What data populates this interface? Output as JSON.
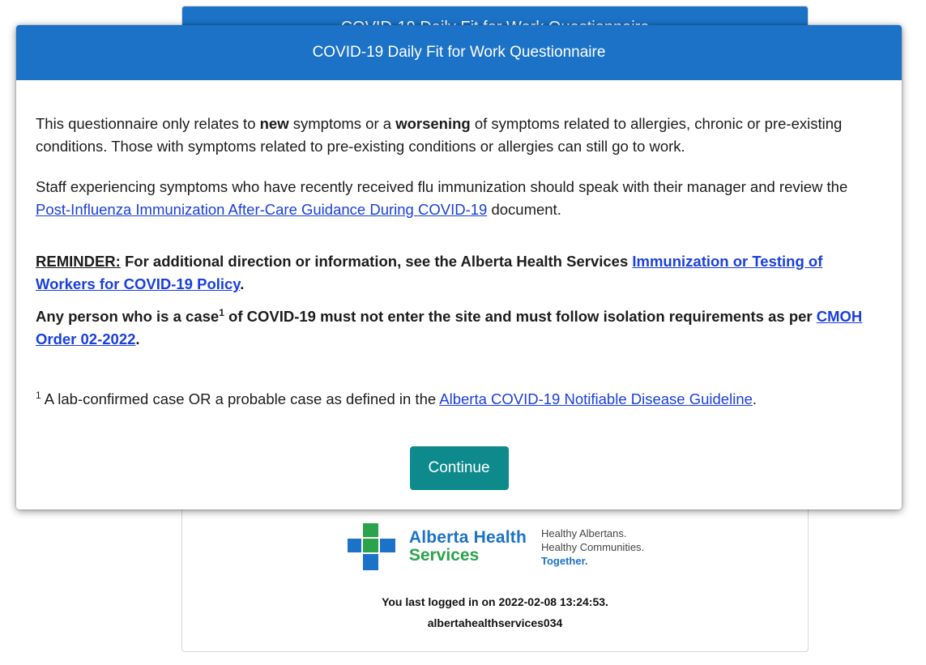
{
  "background": {
    "title": "COVID-19 Daily Fit for Work Questionnaire",
    "logo": {
      "line1": "Alberta Health",
      "line2": "Services",
      "tagline1": "Healthy Albertans.",
      "tagline2": "Healthy Communities.",
      "tagline3": "Together."
    },
    "last_login": "You last logged in on 2022-02-08 13:24:53.",
    "username": "albertahealthservices034"
  },
  "modal": {
    "title": "COVID-19 Daily Fit for Work Questionnaire",
    "p1": {
      "a": "This questionnaire only relates to ",
      "b": "new",
      "c": " symptoms or a ",
      "d": "worsening",
      "e": " of symptoms related to allergies, chronic or pre-existing conditions. Those with symptoms related to pre-existing conditions or allergies can still go to work."
    },
    "p2": {
      "a": "Staff experiencing symptoms who have recently received flu immunization should speak with their manager and review the ",
      "link": "Post-Influenza Immunization After-Care Guidance During COVID-19",
      "b": " document."
    },
    "p3": {
      "label": "REMINDER:",
      "a": " For additional direction or information, see the Alberta Health Services ",
      "link": "Immunization or Testing of Workers for COVID-19 Policy",
      "b": "."
    },
    "p4": {
      "a": "Any person who is a case",
      "sup": "1",
      "b": " of COVID-19 must not enter the site and must follow isolation requirements as per ",
      "link": "CMOH Order 02-2022",
      "c": "."
    },
    "footnote": {
      "sup": "1",
      "a": " A lab-confirmed case OR a probable case as defined in the ",
      "link": "Alberta COVID-19 Notifiable Disease Guideline",
      "b": "."
    },
    "continue_label": "Continue"
  },
  "colors": {
    "header_blue": "#1b72c6",
    "button_teal": "#0e8a8c",
    "link_blue": "#1a3fdb",
    "logo_green": "#2aa34a"
  }
}
